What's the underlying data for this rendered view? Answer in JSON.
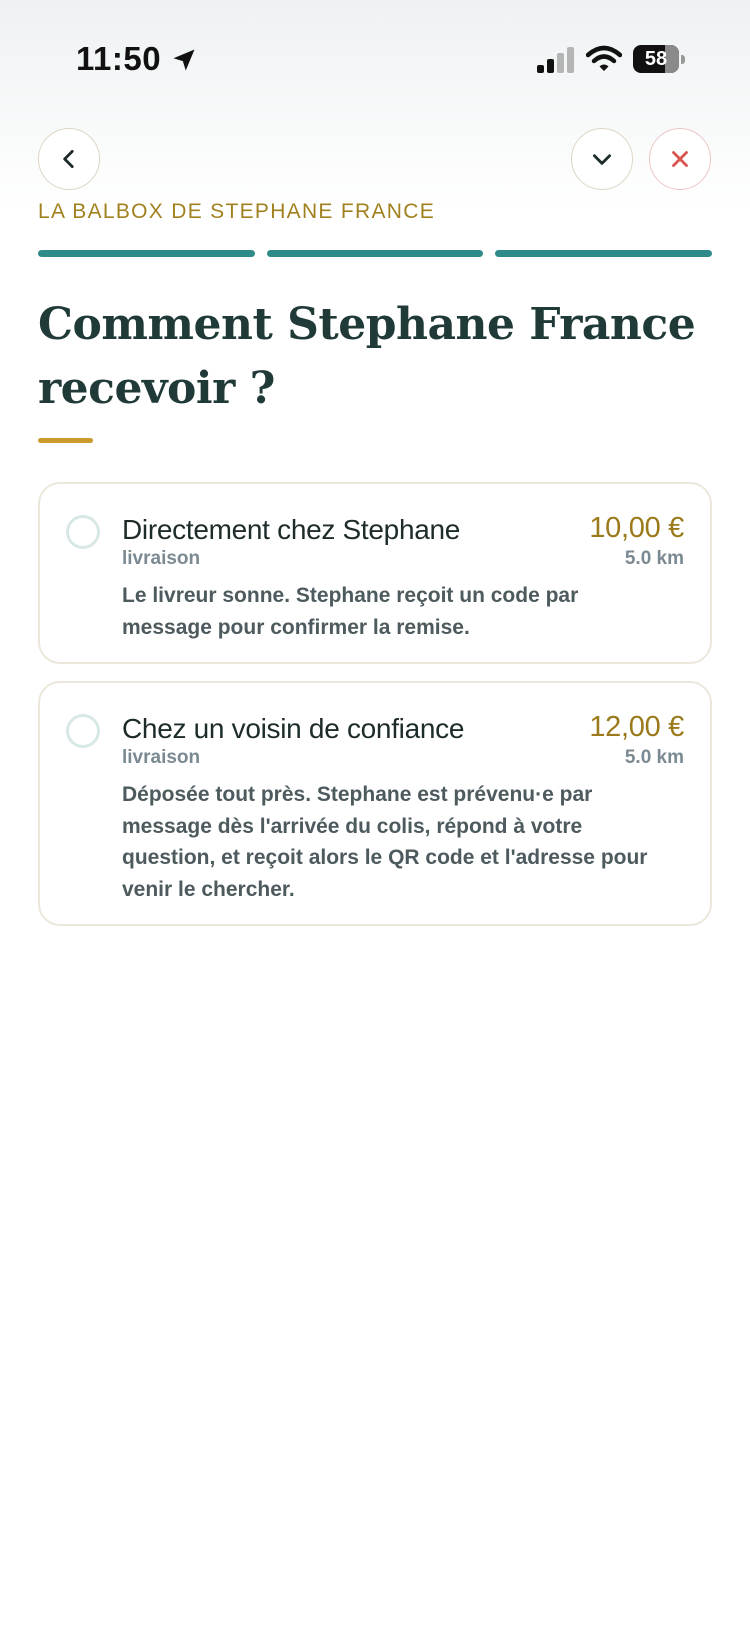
{
  "status_bar": {
    "time": "11:50",
    "battery": "58",
    "icons": [
      "location-arrow-icon",
      "signal-icon",
      "wifi-icon",
      "battery-icon"
    ]
  },
  "nav": {
    "back_icon": "chevron-left-icon",
    "collapse_icon": "chevron-down-icon",
    "close_icon": "close-icon"
  },
  "eyebrow": "LA BALBOX DE STEPHANE FRANCE",
  "progress": {
    "steps_total": 3,
    "steps_completed": 3,
    "color": "#2f8b89"
  },
  "title": "Comment Stephane France recevoir ?",
  "accent_color": "#c99a2c",
  "options": [
    {
      "title": "Directement chez Stephane",
      "subtitle": "livraison",
      "price": "10,00 €",
      "distance": "5.0 km",
      "description": "Le livreur sonne. Stephane reçoit un code par message pour confirmer la remise.",
      "selected": false
    },
    {
      "title": "Chez un voisin de confiance",
      "subtitle": "livraison",
      "price": "12,00 €",
      "distance": "5.0 km",
      "description": "Déposée tout près. Stephane est prévenu·e par message dès l'arrivée du colis, répond à votre question, et reçoit alors le QR code et l'adresse pour venir le chercher.",
      "selected": false
    }
  ]
}
